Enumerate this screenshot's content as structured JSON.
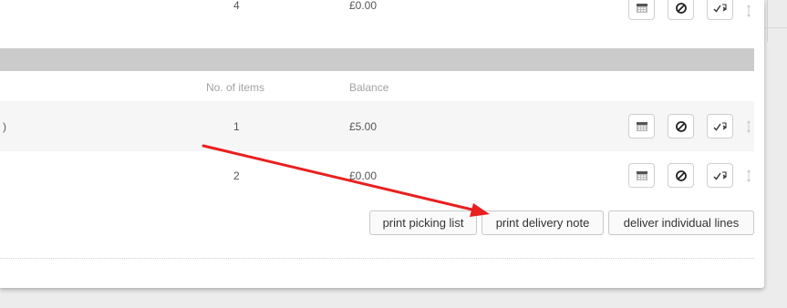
{
  "top_row": {
    "items": "4",
    "balance": "£0.00"
  },
  "table": {
    "headers": {
      "items": "No. of items",
      "balance": "Balance"
    },
    "rows": [
      {
        "id_fragment": ")",
        "items": "1",
        "balance": "£5.00"
      },
      {
        "id_fragment": "",
        "items": "2",
        "balance": "£0.00"
      }
    ]
  },
  "actions": {
    "print_picking_list": "print picking list",
    "print_delivery_note": "print delivery note",
    "deliver_individual_lines": "deliver individual lines"
  },
  "icons": {
    "calendar": "calendar-icon",
    "cancel": "ban-icon",
    "deliver": "check-delivery-icon",
    "reorder": "drag-handle-icon"
  },
  "colors": {
    "annotation_arrow": "#e8201f",
    "header_bar": "#cbcbcb"
  }
}
